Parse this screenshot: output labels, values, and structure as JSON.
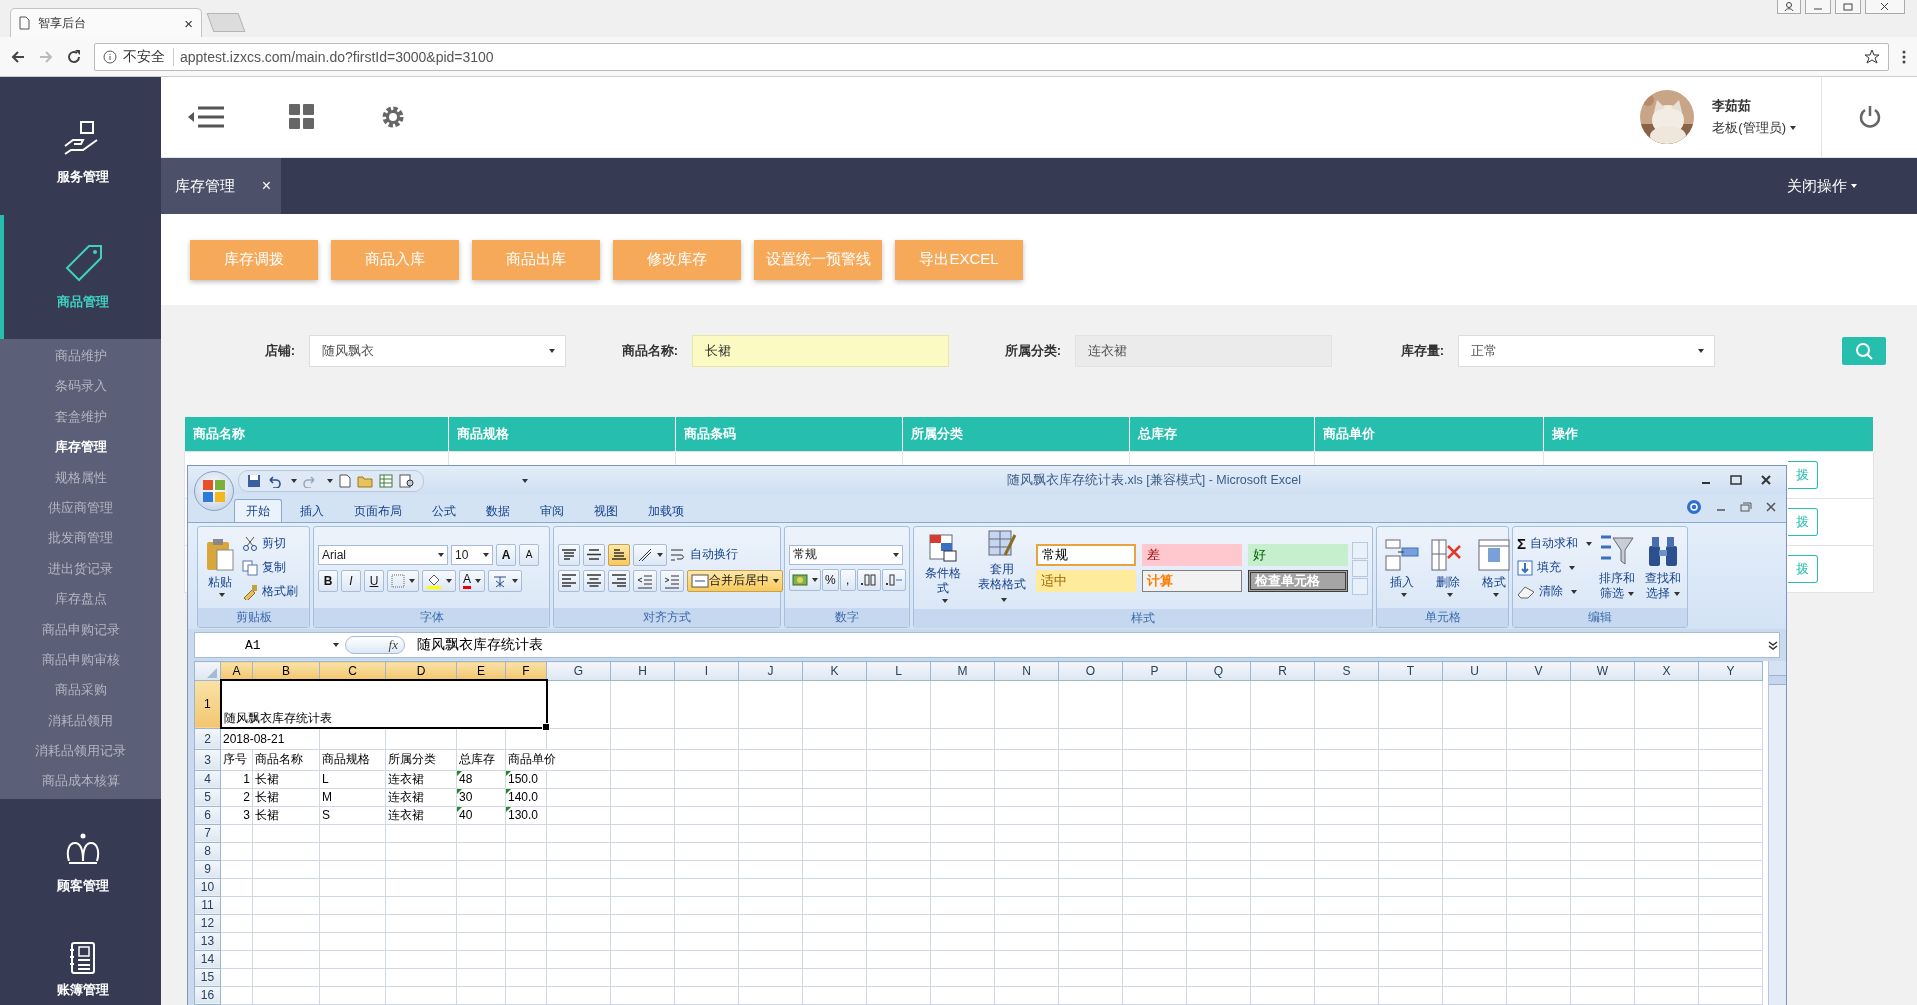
{
  "browser": {
    "tab_title": "智享后台",
    "tab_close": "×",
    "security": "不安全",
    "url": "apptest.izxcs.com/main.do?firstId=3000&pid=3100"
  },
  "header": {
    "user_name": "李茹茹",
    "user_role": "老板(管理员)"
  },
  "sidebar": [
    {
      "label": "服务管理",
      "kind": "service",
      "selected": false
    },
    {
      "label": "商品管理",
      "kind": "goods",
      "selected": true,
      "children": [
        {
          "label": "商品维护",
          "selected": false
        },
        {
          "label": "条码录入",
          "selected": false
        },
        {
          "label": "套盒维护",
          "selected": false
        },
        {
          "label": "库存管理",
          "selected": true
        },
        {
          "label": "规格属性",
          "selected": false
        },
        {
          "label": "供应商管理",
          "selected": false
        },
        {
          "label": "批发商管理",
          "selected": false
        },
        {
          "label": "进出货记录",
          "selected": false
        },
        {
          "label": "库存盘点",
          "selected": false
        },
        {
          "label": "商品申购记录",
          "selected": false
        },
        {
          "label": "商品申购审核",
          "selected": false
        },
        {
          "label": "商品采购",
          "selected": false
        },
        {
          "label": "消耗品领用",
          "selected": false
        },
        {
          "label": "消耗品领用记录",
          "selected": false
        },
        {
          "label": "商品成本核算",
          "selected": false
        }
      ]
    },
    {
      "label": "顾客管理",
      "kind": "customer",
      "selected": false
    },
    {
      "label": "账簿管理",
      "kind": "ledger",
      "selected": false
    }
  ],
  "page_tabs": [
    {
      "label": "库存管理",
      "close": "×",
      "selected": true
    }
  ],
  "close_ops": "关闭操作",
  "action_buttons": [
    "库存调拨",
    "商品入库",
    "商品出库",
    "修改库存",
    "设置统一预警线",
    "导出EXCEL"
  ],
  "filters": [
    {
      "label": "店铺:",
      "kind": "select",
      "value": "随风飘衣"
    },
    {
      "label": "商品名称:",
      "kind": "input",
      "value": "长裙"
    },
    {
      "label": "所属分类:",
      "kind": "readonly",
      "value": "连衣裙"
    },
    {
      "label": "库存量:",
      "kind": "select",
      "value": "正常"
    }
  ],
  "table": {
    "columns": [
      "商品名称",
      "商品规格",
      "商品条码",
      "所属分类",
      "总库存",
      "商品单价",
      "操作"
    ],
    "rows": [
      {
        "action": "拨"
      },
      {
        "action": "拨"
      },
      {
        "action": "拨"
      }
    ]
  },
  "excel": {
    "title": "随风飘衣库存统计表.xls  [兼容模式] - Microsoft Excel",
    "tabs": [
      {
        "label": "开始",
        "selected": true
      },
      {
        "label": "插入",
        "selected": false
      },
      {
        "label": "页面布局",
        "selected": false
      },
      {
        "label": "公式",
        "selected": false
      },
      {
        "label": "数据",
        "selected": false
      },
      {
        "label": "审阅",
        "selected": false
      },
      {
        "label": "视图",
        "selected": false
      },
      {
        "label": "加载项",
        "selected": false
      }
    ],
    "clipboard": {
      "paste": "粘贴",
      "items": [
        {
          "kind": "cut",
          "label": "剪切"
        },
        {
          "kind": "copy",
          "label": "复制"
        },
        {
          "kind": "brush",
          "label": "格式刷"
        }
      ],
      "label": "剪贴板"
    },
    "font": {
      "name": "Arial",
      "size": "10",
      "grow": "A",
      "shrink": "A",
      "styles": [
        "B",
        "I",
        "U"
      ],
      "color_label": "A",
      "label": "字体"
    },
    "alignment": {
      "vertical": [
        {
          "kind": "top",
          "selected": false
        },
        {
          "kind": "middle",
          "selected": false
        },
        {
          "kind": "bottom",
          "selected": true
        }
      ],
      "horizontal": [
        {
          "kind": "left",
          "selected": false
        },
        {
          "kind": "center",
          "selected": false
        },
        {
          "kind": "right",
          "selected": false
        }
      ],
      "wrap": {
        "label": "自动换行",
        "selected": false
      },
      "merge": {
        "label": "合并后居中",
        "selected": true
      },
      "label": "对齐方式"
    },
    "number": {
      "format": "常规",
      "symbols": [
        "%",
        ","
      ],
      "label": "数字"
    },
    "styles": {
      "conditional": "条件格式",
      "table_format": [
        "套用",
        "表格格式"
      ],
      "cell_styles": [
        {
          "label": "常规",
          "kind": "normal",
          "selected": true
        },
        {
          "label": "差",
          "kind": "bad",
          "selected": false
        },
        {
          "label": "好",
          "kind": "good",
          "selected": false
        },
        {
          "label": "适中",
          "kind": "neutral",
          "selected": false
        },
        {
          "label": "计算",
          "kind": "calculation",
          "selected": false
        },
        {
          "label": "检查单元格",
          "kind": "check",
          "selected": false
        }
      ],
      "label": "样式"
    },
    "cells": {
      "items": [
        {
          "kind": "insert",
          "label": "插入"
        },
        {
          "kind": "delete",
          "label": "删除"
        },
        {
          "kind": "format",
          "label": "格式"
        }
      ],
      "label": "单元格"
    },
    "editing": {
      "sum_symbol": "Σ",
      "items": [
        {
          "kind": "sum",
          "label": "自动求和"
        },
        {
          "kind": "fill",
          "label": "填充"
        },
        {
          "kind": "clear",
          "label": "清除"
        }
      ],
      "big": [
        {
          "kind": "sort",
          "lines": [
            "排序和",
            "筛选"
          ]
        },
        {
          "kind": "find",
          "lines": [
            "查找和",
            "选择"
          ]
        }
      ],
      "label": "编辑"
    },
    "formula_bar": {
      "name_box": "A1",
      "fx": "fx",
      "value": "随风飘衣库存统计表"
    },
    "sheet": {
      "columns": [
        {
          "label": "A",
          "selected": true
        },
        {
          "label": "B",
          "selected": true
        },
        {
          "label": "C",
          "selected": true
        },
        {
          "label": "D",
          "selected": true
        },
        {
          "label": "E",
          "selected": true
        },
        {
          "label": "F",
          "selected": true
        },
        {
          "label": "G",
          "selected": false
        },
        {
          "label": "H",
          "selected": false
        },
        {
          "label": "I",
          "selected": false
        },
        {
          "label": "J",
          "selected": false
        },
        {
          "label": "K",
          "selected": false
        },
        {
          "label": "L",
          "selected": false
        },
        {
          "label": "M",
          "selected": false
        },
        {
          "label": "N",
          "selected": false
        },
        {
          "label": "O",
          "selected": false
        },
        {
          "label": "P",
          "selected": false
        },
        {
          "label": "Q",
          "selected": false
        },
        {
          "label": "R",
          "selected": false
        },
        {
          "label": "S",
          "selected": false
        },
        {
          "label": "T",
          "selected": false
        },
        {
          "label": "U",
          "selected": false
        },
        {
          "label": "V",
          "selected": false
        },
        {
          "label": "W",
          "selected": false
        },
        {
          "label": "X",
          "selected": false
        },
        {
          "label": "Y",
          "selected": false
        }
      ],
      "rows": [
        {
          "label": "1",
          "selected": true,
          "merged": true,
          "cells": [
            {
              "text": "随风飘衣库存统计表"
            }
          ]
        },
        {
          "label": "2",
          "selected": false,
          "cells": [
            {
              "text": "2018-08-21"
            }
          ]
        },
        {
          "label": "3",
          "selected": false,
          "cells": [
            {
              "text": "序号"
            },
            {
              "text": "商品名称"
            },
            {
              "text": "商品规格"
            },
            {
              "text": "所属分类"
            },
            {
              "text": "总库存"
            },
            {
              "text": "商品单价"
            }
          ]
        },
        {
          "label": "4",
          "selected": false,
          "cells": [
            {
              "text": "1",
              "kind": "number"
            },
            {
              "text": "长裙"
            },
            {
              "text": "L"
            },
            {
              "text": "连衣裙"
            },
            {
              "text": "48",
              "warn": true
            },
            {
              "text": "150.0",
              "warn": true
            }
          ]
        },
        {
          "label": "5",
          "selected": false,
          "cells": [
            {
              "text": "2",
              "kind": "number"
            },
            {
              "text": "长裙"
            },
            {
              "text": "M"
            },
            {
              "text": "连衣裙"
            },
            {
              "text": "30",
              "warn": true
            },
            {
              "text": "140.0",
              "warn": true
            }
          ]
        },
        {
          "label": "6",
          "selected": false,
          "cells": [
            {
              "text": "3",
              "kind": "number"
            },
            {
              "text": "长裙"
            },
            {
              "text": "S"
            },
            {
              "text": "连衣裙"
            },
            {
              "text": "40",
              "warn": true
            },
            {
              "text": "130.0",
              "warn": true
            }
          ]
        },
        {
          "label": "7",
          "selected": false
        },
        {
          "label": "8",
          "selected": false
        },
        {
          "label": "9",
          "selected": false
        },
        {
          "label": "10",
          "selected": false
        },
        {
          "label": "11",
          "selected": false
        },
        {
          "label": "12",
          "selected": false
        },
        {
          "label": "13",
          "selected": false
        },
        {
          "label": "14",
          "selected": false
        },
        {
          "label": "15",
          "selected": false
        },
        {
          "label": "16",
          "selected": false
        }
      ]
    }
  }
}
